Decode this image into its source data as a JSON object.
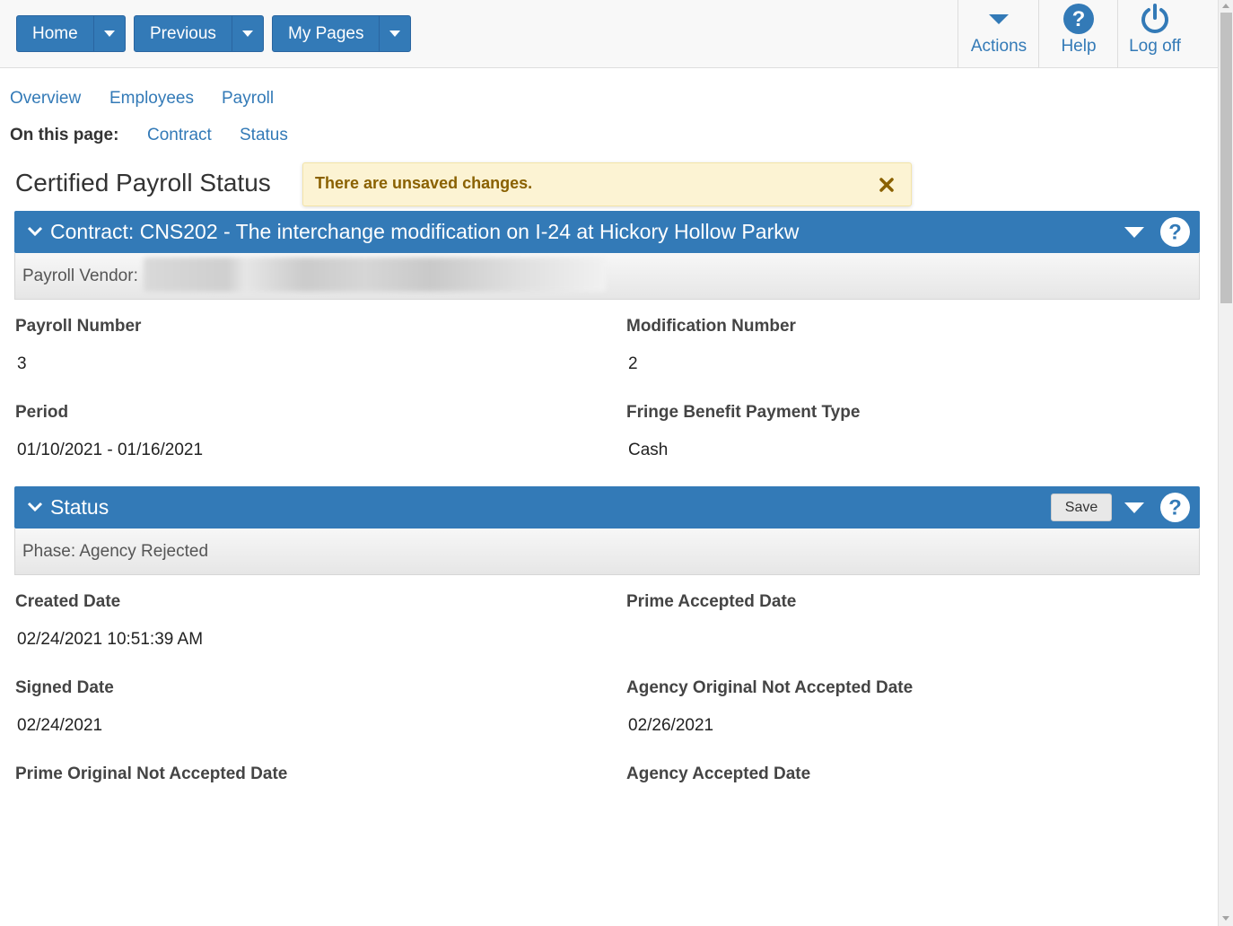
{
  "nav": {
    "home": "Home",
    "previous": "Previous",
    "my_pages": "My Pages"
  },
  "top_actions": {
    "actions": "Actions",
    "help": "Help",
    "logoff": "Log off"
  },
  "links": {
    "overview": "Overview",
    "employees": "Employees",
    "payroll": "Payroll"
  },
  "on_this_page": {
    "label": "On this page:",
    "contract": "Contract",
    "status": "Status"
  },
  "page_title": "Certified Payroll Status",
  "alert": {
    "text": "There are unsaved changes."
  },
  "contract_section": {
    "title": "Contract: CNS202 - The interchange modification on I-24 at Hickory Hollow Parkw",
    "vendor_label": "Payroll Vendor:"
  },
  "contract_fields": {
    "payroll_number_label": "Payroll Number",
    "payroll_number": "3",
    "modification_number_label": "Modification Number",
    "modification_number": "2",
    "period_label": "Period",
    "period": "01/10/2021 - 01/16/2021",
    "fringe_label": "Fringe Benefit Payment Type",
    "fringe": "Cash"
  },
  "status_section": {
    "title": "Status",
    "save": "Save",
    "phase": "Phase: Agency Rejected"
  },
  "status_fields": {
    "created_label": "Created Date",
    "created": "02/24/2021 10:51:39 AM",
    "prime_accepted_label": "Prime Accepted Date",
    "signed_label": "Signed Date",
    "signed": "02/24/2021",
    "agency_orig_not_accepted_label": "Agency Original Not Accepted Date",
    "agency_orig_not_accepted": "02/26/2021",
    "prime_orig_not_accepted_label": "Prime Original Not Accepted Date",
    "agency_accepted_label": "Agency Accepted Date"
  },
  "colors": {
    "primary": "#337ab7",
    "alert_bg": "#fcf3d3",
    "alert_text": "#8a6100"
  }
}
